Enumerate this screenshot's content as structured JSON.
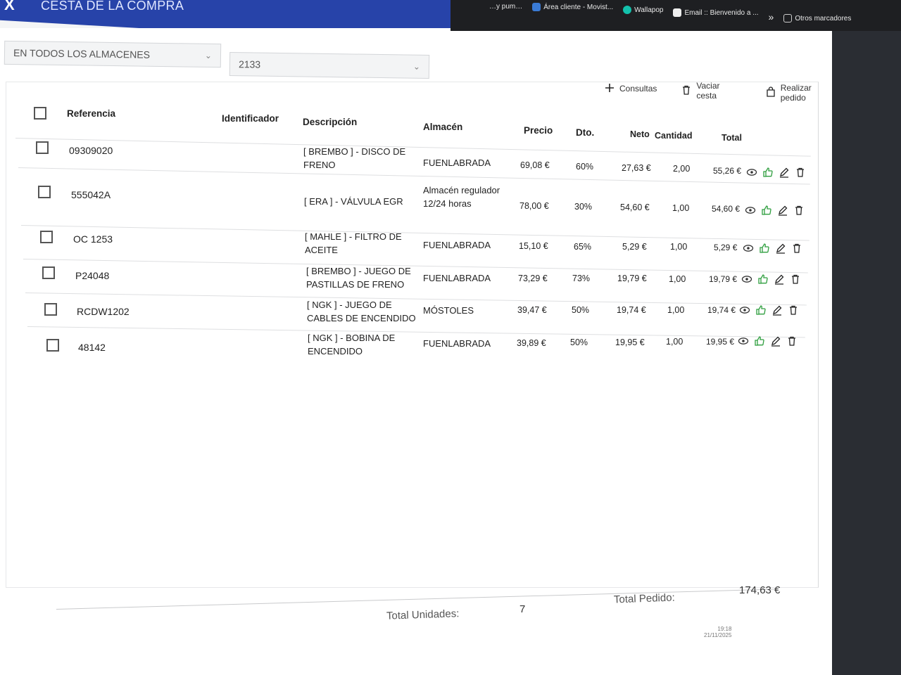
{
  "browser": {
    "bookmarks": [
      {
        "label": "…y pum…",
        "icon": "page-icon"
      },
      {
        "label": "Área cliente - Movist...",
        "icon": "movistar-icon"
      },
      {
        "label": "Wallapop",
        "icon": "wallapop-icon"
      },
      {
        "label": "Email :: Bienvenido a ...",
        "icon": "email-icon"
      },
      {
        "label": "Otros marcadores",
        "icon": "folder-icon"
      }
    ],
    "overflow_label": "»"
  },
  "header": {
    "close_label": "X",
    "title": "CESTA DE LA COMPRA",
    "accent_color": "#2743a9"
  },
  "filters": {
    "warehouse": {
      "value": "EN TODOS LOS ALMACENES"
    },
    "client": {
      "value": "2133"
    }
  },
  "toolbar": {
    "consultas": "Consultas",
    "vaciar": "Vaciar cesta",
    "realizar": "Realizar pedido"
  },
  "table": {
    "columns": {
      "referencia": "Referencia",
      "identificador": "Identificador",
      "descripcion": "Descripción",
      "almacen": "Almacén",
      "precio": "Precio",
      "dto": "Dto.",
      "neto": "Neto",
      "cantidad": "Cantidad",
      "total": "Total"
    },
    "rows": [
      {
        "ref": "09309020",
        "id": "",
        "desc": "[ BREMBO ] - DISCO DE FRENO",
        "almacen": "FUENLABRADA",
        "precio": "69,08 €",
        "dto": "60%",
        "neto": "27,63 €",
        "cantidad": "2,00",
        "total": "55,26 €"
      },
      {
        "ref": "555042A",
        "id": "",
        "desc": "[ ERA ] - VÁLVULA EGR",
        "almacen": "Almacén regulador 12/24 horas",
        "precio": "78,00 €",
        "dto": "30%",
        "neto": "54,60 €",
        "cantidad": "1,00",
        "total": "54,60 €"
      },
      {
        "ref": "OC 1253",
        "id": "",
        "desc": "[ MAHLE ] - FILTRO DE ACEITE",
        "almacen": "FUENLABRADA",
        "precio": "15,10 €",
        "dto": "65%",
        "neto": "5,29 €",
        "cantidad": "1,00",
        "total": "5,29 €"
      },
      {
        "ref": "P24048",
        "id": "",
        "desc": "[ BREMBO ] - JUEGO DE PASTILLAS DE FRENO",
        "almacen": "FUENLABRADA",
        "precio": "73,29 €",
        "dto": "73%",
        "neto": "19,79 €",
        "cantidad": "1,00",
        "total": "19,79 €"
      },
      {
        "ref": "RCDW1202",
        "id": "",
        "desc": "[ NGK ] - JUEGO DE CABLES DE ENCENDIDO",
        "almacen": "MÓSTOLES",
        "precio": "39,47 €",
        "dto": "50%",
        "neto": "19,74 €",
        "cantidad": "1,00",
        "total": "19,74 €"
      },
      {
        "ref": "48142",
        "id": "",
        "desc": "[ NGK ] - BOBINA DE ENCENDIDO",
        "almacen": "FUENLABRADA",
        "precio": "39,89 €",
        "dto": "50%",
        "neto": "19,95 €",
        "cantidad": "1,00",
        "total": "19,95 €"
      }
    ],
    "row_actions": [
      "eye-icon",
      "thumbs-up-icon",
      "pencil-icon",
      "trash-icon"
    ],
    "thumb_color": "#2e9e3e"
  },
  "totals": {
    "unidades_label": "Total Unidades:",
    "unidades_value": "7",
    "pedido_label": "Total Pedido:",
    "pedido_value": "174,63 €"
  },
  "system_tray": {
    "time": "19:18",
    "date": "21/11/2025"
  }
}
